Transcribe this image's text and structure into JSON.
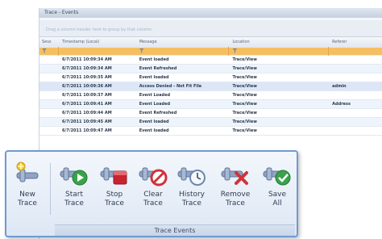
{
  "window": {
    "title": "Trace - Events",
    "group_hint": "Drag a column header here to group by that column"
  },
  "grid": {
    "columns": [
      "Sess",
      "Timestamp (Local)",
      "Message",
      "Location",
      "Referer"
    ],
    "rows": [
      {
        "timestamp": "6/7/2011 10:09:34 AM",
        "message": "Event loaded",
        "location": "Trace/View",
        "extra": ""
      },
      {
        "timestamp": "6/7/2011 10:09:34 AM",
        "message": "Event Refreshed",
        "location": "Trace/View",
        "extra": ""
      },
      {
        "timestamp": "6/7/2011 10:09:35 AM",
        "message": "Event loaded",
        "location": "Trace/View",
        "extra": ""
      },
      {
        "timestamp": "6/7/2011 10:09:36 AM",
        "message": "Access Denied - Not Fit File",
        "location": "Trace/View",
        "extra": "admin"
      },
      {
        "timestamp": "6/7/2011 10:09:37 AM",
        "message": "Event Loaded",
        "location": "Trace/View",
        "extra": ""
      },
      {
        "timestamp": "6/7/2011 10:09:41 AM",
        "message": "Event Loaded",
        "location": "Trace/View",
        "extra": "Address"
      },
      {
        "timestamp": "6/7/2011 10:09:44 AM",
        "message": "Event Refreshed",
        "location": "Trace/View",
        "extra": ""
      },
      {
        "timestamp": "6/7/2011 10:09:45 AM",
        "message": "Event loaded",
        "location": "Trace/View",
        "extra": ""
      },
      {
        "timestamp": "6/7/2011 10:09:47 AM",
        "message": "Event loaded",
        "location": "Trace/View",
        "extra": ""
      }
    ]
  },
  "ribbon": {
    "buttons": [
      {
        "line1": "New",
        "line2": "Trace",
        "icon": "new-trace-icon"
      },
      {
        "line1": "Start",
        "line2": "Trace",
        "icon": "start-trace-icon"
      },
      {
        "line1": "Stop",
        "line2": "Trace",
        "icon": "stop-trace-icon"
      },
      {
        "line1": "Clear",
        "line2": "Trace",
        "icon": "clear-trace-icon"
      },
      {
        "line1": "History",
        "line2": "Trace",
        "icon": "history-trace-icon"
      },
      {
        "line1": "Remove",
        "line2": "Trace",
        "icon": "remove-trace-icon"
      },
      {
        "line1": "Save",
        "line2": "All",
        "icon": "save-all-icon"
      }
    ],
    "group_label": "Trace Events"
  },
  "colors": {
    "filter_row": "#f5bf61",
    "ribbon_border": "#6f9bd1",
    "pipe": "#8fa3c4",
    "green": "#3aa24a",
    "red": "#d0323a"
  }
}
